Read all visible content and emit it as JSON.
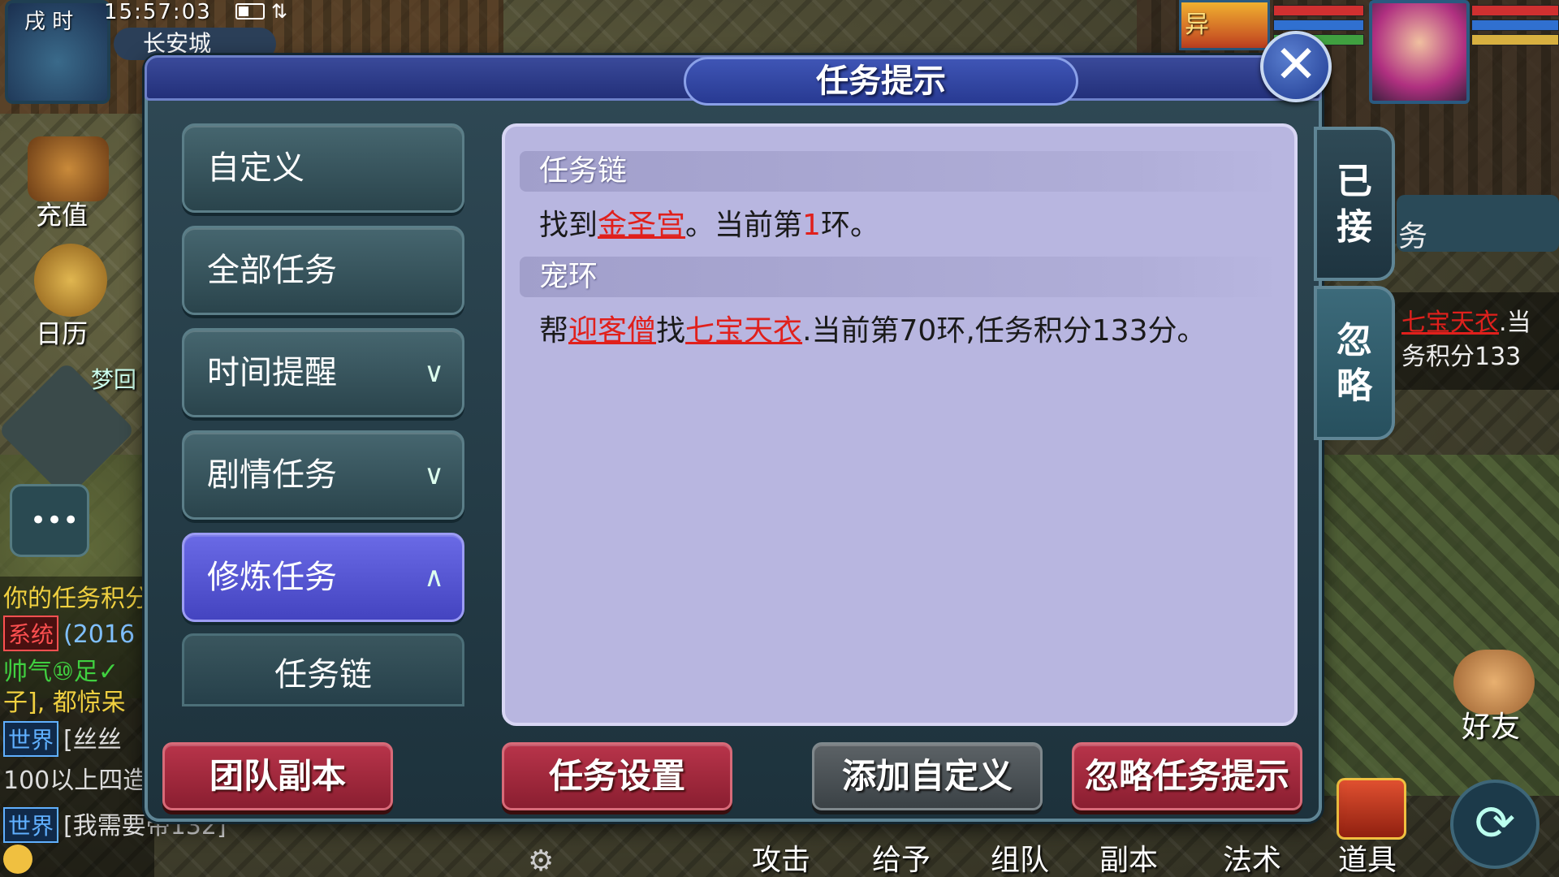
{
  "hud": {
    "time_period": "戌 时",
    "clock": "15:57:03",
    "location": "长安城",
    "recharge": "充值",
    "calendar": "日历",
    "dream_partial": "梦回",
    "pet_char": "异"
  },
  "chat": {
    "line1": "你的任务积分",
    "tag_system": "系统",
    "line2": "(2016",
    "line3": "帅气⑩足✓",
    "line4": "子], 都惊呆",
    "tag_world": "世界",
    "line5": "[丝丝",
    "line6": "100以上四造",
    "line7": "[我需要带132]"
  },
  "behind_panel": {
    "task_char": "务",
    "item": "七宝天衣",
    "suffix": ".当",
    "points": "务积分133"
  },
  "bottom_menu": {
    "attack": "攻击",
    "give": "给予",
    "team": "组队",
    "dungeon": "副本",
    "magic": "法术",
    "items": "道具",
    "friends": "好友"
  },
  "dialog": {
    "title": "任务提示",
    "close_glyph": "✕",
    "categories": [
      {
        "label": "自定义"
      },
      {
        "label": "全部任务"
      },
      {
        "label": "时间提醒"
      },
      {
        "label": "剧情任务"
      },
      {
        "label": "修炼任务"
      }
    ],
    "sub_item": "任务链",
    "chevron_down": "∨",
    "chevron_up": "∧",
    "tabs": {
      "accepted": "已接",
      "ignored": "忽略"
    },
    "tasks": [
      {
        "name": "任务链",
        "p1": "找到",
        "target": "金圣宫",
        "p2": "。当前第",
        "round": "1",
        "p3": "环。"
      },
      {
        "name": "宠环",
        "p1": "帮",
        "npc": "迎客僧",
        "p2": "找",
        "item": "七宝天衣",
        "p3": ".当前第70环,任务积分133分。"
      }
    ],
    "buttons": {
      "team_dungeon": "团队副本",
      "task_settings": "任务设置",
      "add_custom": "添加自定义",
      "ignore_hint": "忽略任务提示"
    }
  },
  "colors": {
    "dialog_bg": "#2f4955",
    "content_bg": "#b8b6e0",
    "active_tab": "#5a5ad8",
    "highlight": "#e0201c",
    "button_red": "#a02a40"
  }
}
